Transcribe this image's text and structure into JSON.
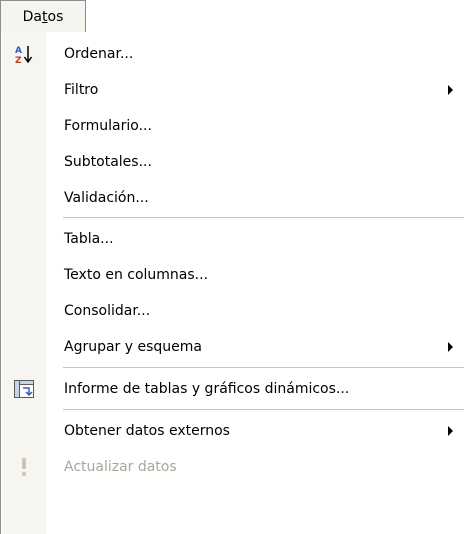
{
  "menu": {
    "title": "Datos",
    "items": [
      {
        "id": "ordenar",
        "label": "Ordenar...",
        "icon": "sort-az-icon",
        "submenu": false,
        "enabled": true
      },
      {
        "id": "filtro",
        "label": "Filtro",
        "icon": null,
        "submenu": true,
        "enabled": true
      },
      {
        "id": "formulario",
        "label": "Formulario...",
        "icon": null,
        "submenu": false,
        "enabled": true
      },
      {
        "id": "subtotales",
        "label": "Subtotales...",
        "icon": null,
        "submenu": false,
        "enabled": true
      },
      {
        "id": "validacion",
        "label": "Validación...",
        "icon": null,
        "submenu": false,
        "enabled": true
      },
      {
        "id": "tabla",
        "label": "Tabla...",
        "icon": null,
        "submenu": false,
        "enabled": true
      },
      {
        "id": "texto",
        "label": "Texto en columnas...",
        "icon": null,
        "submenu": false,
        "enabled": true
      },
      {
        "id": "consolidar",
        "label": "Consolidar...",
        "icon": null,
        "submenu": false,
        "enabled": true
      },
      {
        "id": "agrupar",
        "label": "Agrupar y esquema",
        "icon": null,
        "submenu": true,
        "enabled": true
      },
      {
        "id": "informe",
        "label": "Informe de tablas y gráficos dinámicos...",
        "icon": "pivot-table-icon",
        "submenu": false,
        "enabled": true
      },
      {
        "id": "obtener",
        "label": "Obtener datos externos",
        "icon": null,
        "submenu": true,
        "enabled": true
      },
      {
        "id": "actualizar",
        "label": "Actualizar datos",
        "icon": "refresh-data-icon",
        "submenu": false,
        "enabled": false
      }
    ]
  },
  "colors": {
    "gutter": "#f6f5ef",
    "separator": "#c9c6bd",
    "disabled_text": "#a7a69b",
    "menu_border": "#8d8d8d"
  }
}
